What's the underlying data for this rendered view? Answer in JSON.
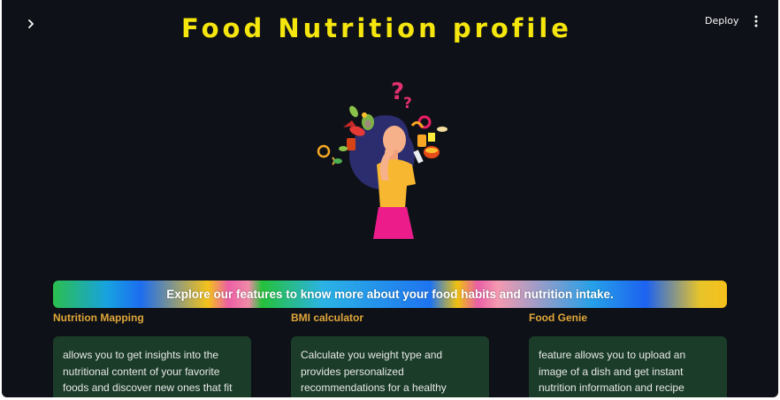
{
  "header": {
    "deploy_label": "Deploy",
    "sidebar_toggle_icon": "chevron-right-icon",
    "menu_icon": "vertical-dots-icon"
  },
  "main": {
    "title": "Food Nutrition profile",
    "illustration": "woman-thinking-about-food",
    "banner_text": "Explore our features to know more about your food habits and nutrition intake."
  },
  "features": [
    {
      "title": "Nutrition Mapping",
      "description": "allows you to get insights into the nutritional content of your favorite foods and discover new ones that fit your"
    },
    {
      "title": "BMI calculator",
      "description": "Calculate you weight type and provides personalized recommendations for a healthy lifestyle"
    },
    {
      "title": "Food Genie",
      "description": "feature allows you to upload an image of a dish and get instant nutrition information and recipe suggestions."
    }
  ],
  "colors": {
    "background": "#0e1117",
    "title": "#f5e60c",
    "feature_title": "#e0a63a",
    "card_background": "#1b3c28"
  }
}
